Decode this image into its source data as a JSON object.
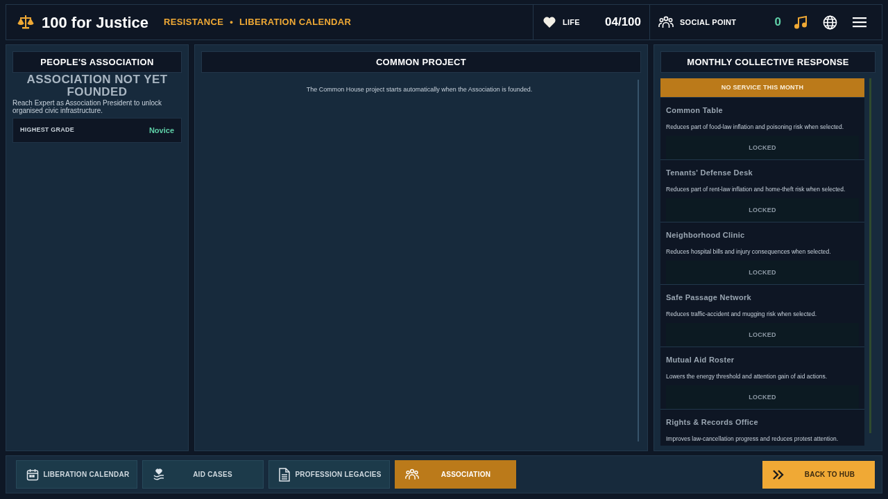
{
  "header": {
    "title": "100 for Justice",
    "breadcrumb": [
      "RESISTANCE",
      "LIBERATION CALENDAR"
    ],
    "separator": "•",
    "life_label": "LIFE",
    "life_value": "04/100",
    "social_label": "SOCIAL POINT",
    "social_value": "0"
  },
  "association_panel": {
    "heading": "PEOPLE'S ASSOCIATION",
    "status": "ASSOCIATION NOT YET FOUNDED",
    "hint": "Reach Expert as Association President to unlock organised civic infrastructure.",
    "grade_label": "HIGHEST GRADE",
    "grade_value": "Novice"
  },
  "project_panel": {
    "heading": "COMMON PROJECT",
    "message": "The Common House project starts automatically when the Association is founded."
  },
  "response_panel": {
    "heading": "MONTHLY COLLECTIVE RESPONSE",
    "banner": "NO SERVICE THIS MONTH",
    "services": [
      {
        "name": "Common Table",
        "description": "Reduces part of food-law inflation and poisoning risk when selected.",
        "status": "LOCKED"
      },
      {
        "name": "Tenants' Defense Desk",
        "description": "Reduces part of rent-law inflation and home-theft risk when selected.",
        "status": "LOCKED"
      },
      {
        "name": "Neighborhood Clinic",
        "description": "Reduces hospital bills and injury consequences when selected.",
        "status": "LOCKED"
      },
      {
        "name": "Safe Passage Network",
        "description": "Reduces traffic-accident and mugging risk when selected.",
        "status": "LOCKED"
      },
      {
        "name": "Mutual Aid Roster",
        "description": "Lowers the energy threshold and attention gain of aid actions.",
        "status": "LOCKED"
      },
      {
        "name": "Rights & Records Office",
        "description": "Improves law-cancellation progress and reduces protest attention."
      }
    ]
  },
  "nav_tabs": [
    {
      "kind": "calendar",
      "label": "LIBERATION CALENDAR",
      "selected": false
    },
    {
      "kind": "aid",
      "label": "AID CASES",
      "selected": false
    },
    {
      "kind": "document",
      "label": "PROFESSION LEGACIES",
      "selected": false
    },
    {
      "kind": "people",
      "label": "ASSOCIATION",
      "selected": true
    }
  ],
  "back_button": "BACK TO HUB"
}
